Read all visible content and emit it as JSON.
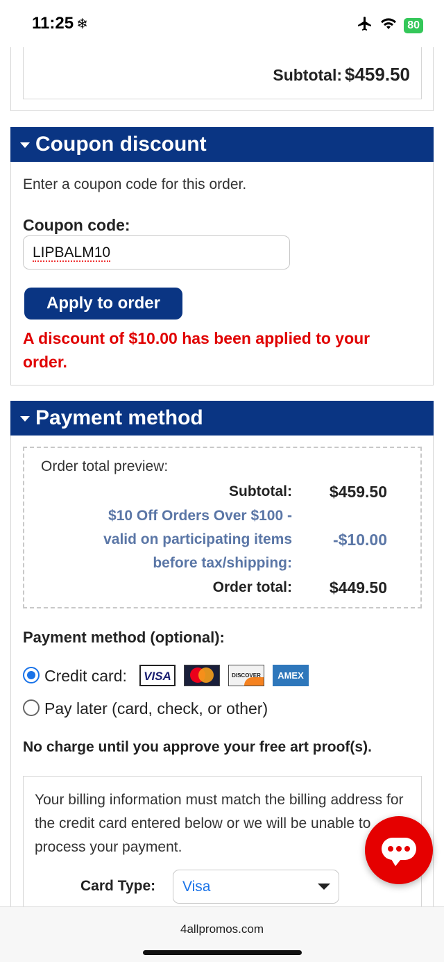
{
  "status_bar": {
    "time": "11:25",
    "battery": "80"
  },
  "order_summary": {
    "subtotal_label": "Subtotal:",
    "subtotal_value": "$459.50"
  },
  "coupon": {
    "header": "Coupon discount",
    "intro": "Enter a coupon code for this order.",
    "code_label": "Coupon code:",
    "code_value": "LIPBALM10",
    "apply_button": "Apply to order",
    "success_message": "A discount of $10.00 has been applied to your order."
  },
  "payment": {
    "header": "Payment method",
    "preview_title": "Order total preview:",
    "rows": [
      {
        "label": "Subtotal:",
        "value": "$459.50"
      },
      {
        "label_line1": "$10 Off Orders Over $100 -",
        "label_line2": "valid on participating items",
        "label_line3": "before tax/shipping:",
        "value": "-$10.00"
      },
      {
        "label": "Order total:",
        "value": "$449.50"
      }
    ],
    "method_label": "Payment method (optional):",
    "options": [
      {
        "label": "Credit card:",
        "selected": true
      },
      {
        "label": "Pay later (card, check, or other)",
        "selected": false
      }
    ],
    "card_logos": [
      "VISA",
      "MasterCard",
      "DISCOVER",
      "AMEX"
    ],
    "no_charge_note": "No charge until you approve your free art proof(s).",
    "billing_note": "Your billing information must match the billing address for the credit card entered below or we will be unable to process your payment.",
    "card_type_label": "Card Type:",
    "card_type_value": "Visa"
  },
  "browser": {
    "url": "4allpromos.com"
  },
  "colors": {
    "header_blue": "#0a3583",
    "error_red": "#e00000",
    "promo_blue": "#5a76a6",
    "chat_red": "#e50000"
  }
}
